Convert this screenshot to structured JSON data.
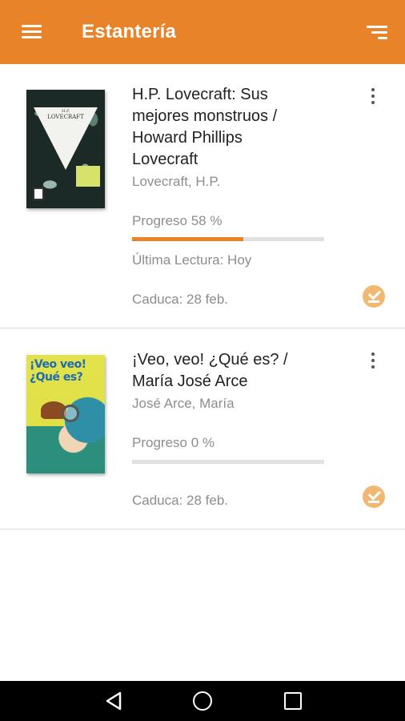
{
  "appbar": {
    "title": "Estantería",
    "menu_icon": "hamburger-menu-icon",
    "sort_icon": "sort-icon",
    "color": "#e8832a"
  },
  "books": [
    {
      "title_lines": [
        "H.P. Lovecraft: Sus",
        "mejores monstruos /",
        "Howard Phillips",
        "Lovecraft"
      ],
      "author": "Lovecraft, H.P.",
      "progress_label": "Progreso 58 %",
      "progress": 0.58,
      "last_read": "Última Lectura: Hoy",
      "expires": "Caduca: 28 feb.",
      "cover": {
        "line1": "H.P.",
        "line2": "LOVECRAFT"
      }
    },
    {
      "title_lines": [
        "¡Veo, veo! ¿Qué es? /",
        "María José Arce"
      ],
      "author": "José Arce, María",
      "progress_label": "Progreso 0 %",
      "progress": 0,
      "expires": "Caduca: 28 feb.",
      "cover": {
        "line1": "¡Veo veo!",
        "line2": "¿Qué es?"
      }
    }
  ],
  "navbar": {
    "back_icon": "back-triangle-icon",
    "home_icon": "home-circle-icon",
    "recent_icon": "recent-apps-square-icon"
  }
}
